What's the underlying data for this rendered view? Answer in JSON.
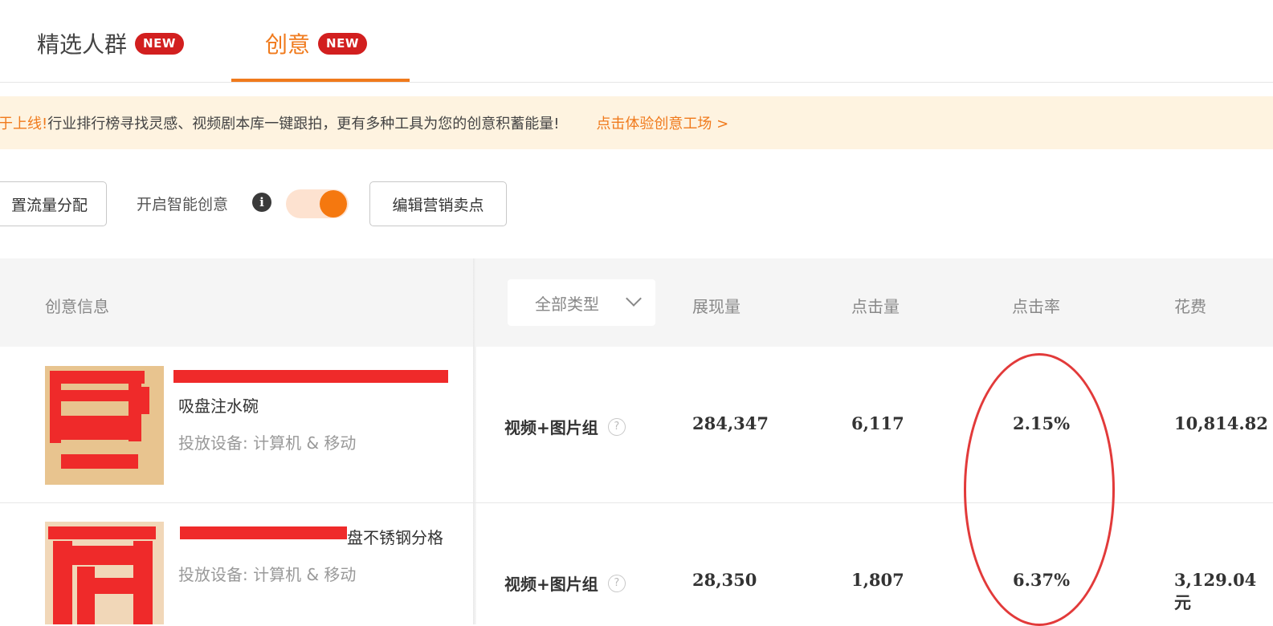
{
  "tabs": [
    {
      "label": "精选人群",
      "badge": "NEW"
    },
    {
      "label": "创意",
      "badge": "NEW"
    }
  ],
  "notice": {
    "lead": "于上线!",
    "text": "行业排行榜寻找灵感、视频剧本库一键跟拍，更有多种工具为您的创意积蓄能量!",
    "link": "点击体验创意工场 >"
  },
  "toolbar": {
    "traffic_button": "置流量分配",
    "smart_label": "开启智能创意",
    "info_icon": "i",
    "smart_toggle_on": true,
    "edit_button": "编辑营销卖点"
  },
  "table": {
    "headers": {
      "info": "创意信息",
      "type_select": "全部类型",
      "impressions": "展现量",
      "clicks": "点击量",
      "ctr": "点击率",
      "cost": "花费"
    },
    "rows": [
      {
        "name_line1": "",
        "name_line2": "吸盘注水碗",
        "device": "投放设备:  计算机 & 移动",
        "type": "视频+图片组",
        "help": "?",
        "impressions": "284,347",
        "clicks": "6,117",
        "ctr": "2.15%",
        "cost": "10,814.82"
      },
      {
        "name_line1": "盘不锈钢分格",
        "device": "投放设备:  计算机 & 移动",
        "type": "视频+图片组",
        "help": "?",
        "impressions": "28,350",
        "clicks": "1,807",
        "ctr": "6.37%",
        "cost": "3,129.04元"
      }
    ]
  },
  "colors": {
    "accent": "#f07a1c",
    "badge": "#d21f1f",
    "notice_bg": "#fef3e0",
    "annotation": "#e23a3a"
  }
}
